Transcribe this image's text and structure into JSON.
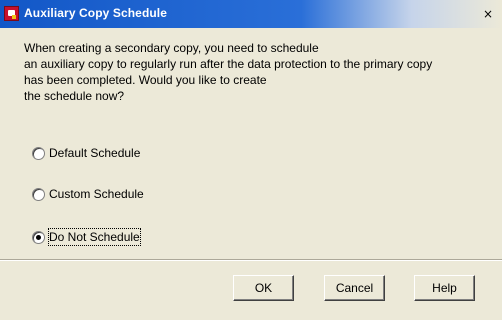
{
  "window": {
    "title": "Auxiliary Copy Schedule",
    "close_glyph": "×",
    "app_icon": "app-logo-icon"
  },
  "message": {
    "lines": [
      "When creating a secondary copy, you need to schedule",
      "an auxiliary copy to regularly run after the data protection to the primary copy",
      "has been completed. Would you like to create",
      "the schedule now?"
    ]
  },
  "options": [
    {
      "label": "Default Schedule",
      "selected": false
    },
    {
      "label": "Custom Schedule",
      "selected": false
    },
    {
      "label": "Do Not Schedule",
      "selected": true
    }
  ],
  "buttons": {
    "ok": "OK",
    "cancel": "Cancel",
    "help": "Help"
  },
  "colors": {
    "titlebar": "#1257c7",
    "dialog_background": "#ece9d8"
  }
}
